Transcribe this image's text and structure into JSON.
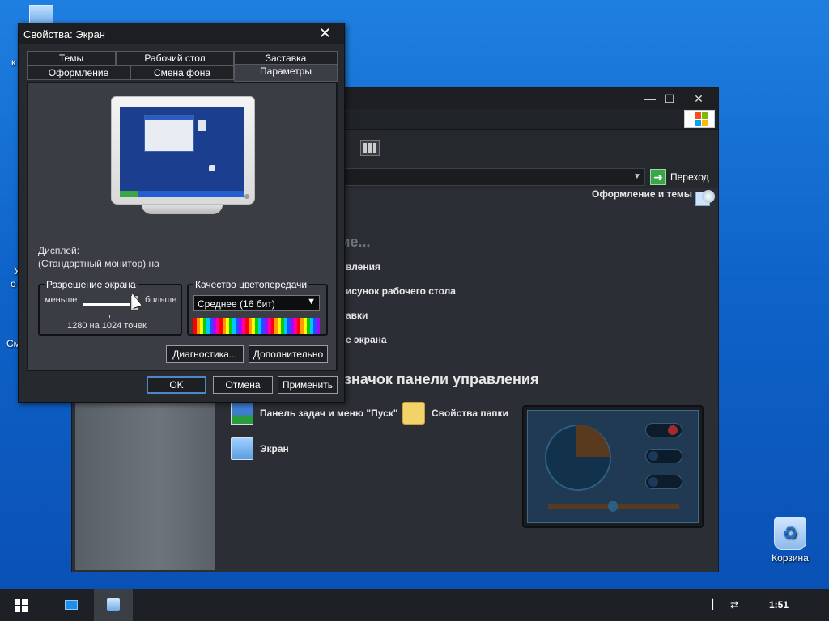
{
  "desktop": {
    "recycle_bin_label": "Корзина",
    "left_labels": [
      "к",
      "У",
      "о",
      "См"
    ]
  },
  "control_panel": {
    "go_label": "Переход",
    "category_link": "Оформление и темы",
    "pick_task_title": "Выберите задание...",
    "tasks": [
      "вления",
      "исунок рабочего стола",
      "авки",
      "е экрана"
    ],
    "pick_icon_title": "значок панели управления",
    "icons": [
      {
        "label": "Панель задач и меню \"Пуск\"",
        "icon": "taskbar-icon"
      },
      {
        "label": "Свойства папки",
        "icon": "folder-options-icon"
      },
      {
        "label": "Экран",
        "icon": "display-icon"
      }
    ]
  },
  "dialog": {
    "title": "Свойства: Экран",
    "tabs_row1": [
      "Темы",
      "Рабочий стол",
      "Заставка"
    ],
    "tabs_row2": [
      "Оформление",
      "Смена фона",
      "Параметры"
    ],
    "active_tab": "Параметры",
    "display_label": "Дисплей:",
    "display_value": "(Стандартный монитор) на",
    "resolution_group": "Разрешение экрана",
    "less": "меньше",
    "more": "больше",
    "resolution_value": "1280 на 1024 точек",
    "color_group": "Качество цветопередачи",
    "color_value": "Среднее (16 бит)",
    "troubleshoot_button": "Диагностика...",
    "advanced_button": "Дополнительно",
    "ok_button": "OK",
    "cancel_button": "Отмена",
    "apply_button": "Применить"
  },
  "taskbar": {
    "clock": "1:51"
  },
  "colors": {
    "desktop": "#0e63c9",
    "window_dark": "#2b2f35",
    "dialog_panel": "#3a3e44",
    "default_button_border": "#4f86c6",
    "go_button": "#3aa64a"
  }
}
